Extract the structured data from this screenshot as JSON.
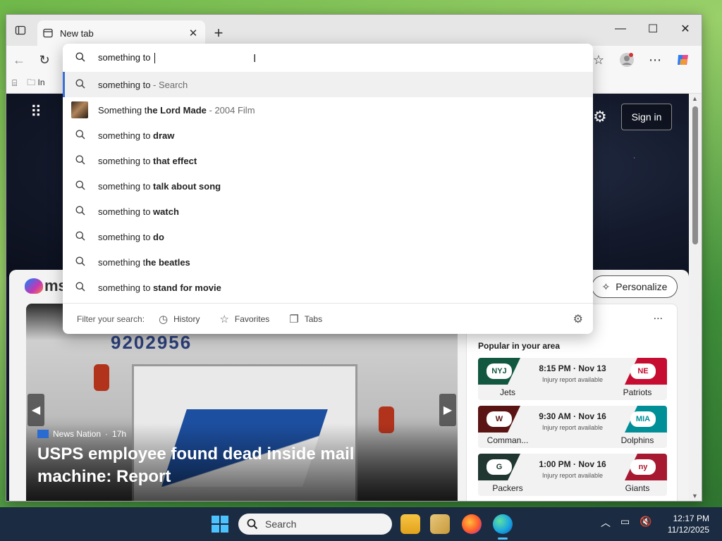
{
  "browser": {
    "tab_title": "New tab",
    "new_tab_symbol": "+",
    "favbar_item": "In"
  },
  "omnibox": {
    "query": "something to ",
    "suggestions": [
      {
        "icon": "search-icon",
        "prefix": "something to",
        "suffix": "",
        "meta": " - Search"
      },
      {
        "icon": "thumbnail",
        "prefix": "Something t",
        "suffix": "he Lord Made",
        "meta": " - 2004 Film"
      },
      {
        "icon": "search-icon",
        "prefix": "something to ",
        "suffix": "draw",
        "meta": ""
      },
      {
        "icon": "search-icon",
        "prefix": "something to ",
        "suffix": "that effect",
        "meta": ""
      },
      {
        "icon": "search-icon",
        "prefix": "something to ",
        "suffix": "talk about song",
        "meta": ""
      },
      {
        "icon": "search-icon",
        "prefix": "something to ",
        "suffix": "watch",
        "meta": ""
      },
      {
        "icon": "search-icon",
        "prefix": "something to ",
        "suffix": "do",
        "meta": ""
      },
      {
        "icon": "search-icon",
        "prefix": "something t",
        "suffix": "he beatles",
        "meta": ""
      },
      {
        "icon": "search-icon",
        "prefix": "something to ",
        "suffix": "stand for movie",
        "meta": ""
      }
    ],
    "filter_label": "Filter your search:",
    "filters": [
      "History",
      "Favorites",
      "Tabs"
    ]
  },
  "page": {
    "sign_in": "Sign in",
    "msn_text": "ms",
    "personalize": "Personalize",
    "news": {
      "truck_number": "9202956",
      "source": "News Nation",
      "age": "17h",
      "headline": "USPS employee found dead inside mail machine: Report"
    },
    "sports": {
      "more": "...",
      "title": "Popular in your area",
      "games": [
        {
          "team_l": "Jets",
          "team_r": "Patriots",
          "time": "8:15 PM · Nov 13",
          "note": "Injury report available",
          "logo_l": "NYJ",
          "logo_r": "NE",
          "color_l": "#125740",
          "color_r": "#c60c30"
        },
        {
          "team_l": "Comman...",
          "team_r": "Dolphins",
          "time": "9:30 AM · Nov 16",
          "note": "Injury report available",
          "logo_l": "W",
          "logo_r": "MIA",
          "color_l": "#5a1414",
          "color_r": "#008e97"
        },
        {
          "team_l": "Packers",
          "team_r": "Giants",
          "time": "1:00 PM · Nov 16",
          "note": "Injury report available",
          "logo_l": "G",
          "logo_r": "ny",
          "color_l": "#203731",
          "color_r": "#a71930"
        }
      ]
    }
  },
  "taskbar": {
    "search_placeholder": "Search",
    "time": "12:17 PM",
    "date": "11/12/2025"
  },
  "colors": {
    "accent": "#3b6fd6",
    "taskbar": "#1b2b42"
  }
}
